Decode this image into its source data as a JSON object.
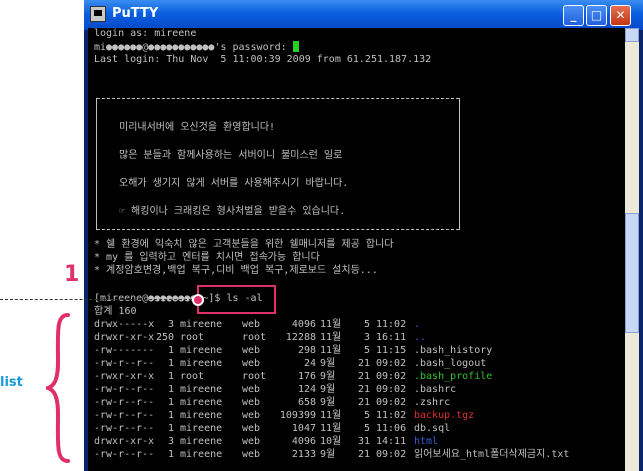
{
  "window": {
    "title": "PuTTY",
    "minimize": "_",
    "maximize": "□",
    "close": "✕"
  },
  "terminal": {
    "login_line": "login as: mireene",
    "password_line": "mi●●●●●●@●●●●●●●●●●●'s password: ",
    "last_login": "Last login: Thu Nov  5 11:00:39 2009 from 61.251.187.132",
    "banner": [
      "미리내서버에 오신것을 환영합니다!",
      "많은 분들과 함께사용하는 서버이니 불미스런 일로",
      "오해가 생기지 않게 서버를 사용해주시기 바랍니다.",
      "☞ 해킹이나 크래킹은 형사처벌을 받을수 있습니다."
    ],
    "notices": [
      "* 쉘 환경에 익숙치 않은 고객분들을 위한 쉘매니저를 제공 합니다",
      "* my 를 입력하고 엔터를 치시면 접속가능 합니다",
      "* 계정암호변경,백업 복구,디비 백업 복구,제로보드 설치등..."
    ],
    "prompt_line": "[mireene@●●●●●●●● ~]$ ls -al",
    "total_line": "합계 160",
    "rows": [
      {
        "perm": "drwx-----x",
        "links": "3",
        "owner": "mireene",
        "group": "web",
        "size": "4096",
        "mon": "11월",
        "day": "5",
        "time": "11:02",
        "name": ".",
        "color": "#3b5bd6"
      },
      {
        "perm": "drwxr-xr-x",
        "links": "250",
        "owner": "root",
        "group": "root",
        "size": "12288",
        "mon": "11월",
        "day": "3",
        "time": "16:11",
        "name": "..",
        "color": "#3b5bd6"
      },
      {
        "perm": "-rw-------",
        "links": "1",
        "owner": "mireene",
        "group": "web",
        "size": "298",
        "mon": "11월",
        "day": "5",
        "time": "11:15",
        "name": ".bash_history",
        "color": "#c0c0c0"
      },
      {
        "perm": "-rw-r--r--",
        "links": "1",
        "owner": "mireene",
        "group": "web",
        "size": "24",
        "mon": "9월",
        "day": "21",
        "time": "09:02",
        "name": ".bash_logout",
        "color": "#c0c0c0"
      },
      {
        "perm": "-rwxr-xr-x",
        "links": "1",
        "owner": "root",
        "group": "root",
        "size": "176",
        "mon": "9월",
        "day": "21",
        "time": "09:02",
        "name": ".bash_profile",
        "color": "#2ec52e"
      },
      {
        "perm": "-rw-r--r--",
        "links": "1",
        "owner": "mireene",
        "group": "web",
        "size": "124",
        "mon": "9월",
        "day": "21",
        "time": "09:02",
        "name": ".bashrc",
        "color": "#c0c0c0"
      },
      {
        "perm": "-rw-r--r--",
        "links": "1",
        "owner": "mireene",
        "group": "web",
        "size": "658",
        "mon": "9월",
        "day": "21",
        "time": "09:02",
        "name": ".zshrc",
        "color": "#c0c0c0"
      },
      {
        "perm": "-rw-r--r--",
        "links": "1",
        "owner": "mireene",
        "group": "web",
        "size": "109399",
        "mon": "11월",
        "day": "5",
        "time": "11:02",
        "name": "backup.tgz",
        "color": "#e03030"
      },
      {
        "perm": "-rw-r--r--",
        "links": "1",
        "owner": "mireene",
        "group": "web",
        "size": "1047",
        "mon": "11월",
        "day": "5",
        "time": "11:06",
        "name": "db.sql",
        "color": "#c0c0c0"
      },
      {
        "perm": "drwxr-xr-x",
        "links": "3",
        "owner": "mireene",
        "group": "web",
        "size": "4096",
        "mon": "10월",
        "day": "31",
        "time": "14:11",
        "name": "html",
        "color": "#3b5bd6"
      },
      {
        "perm": "-rw-r--r--",
        "links": "1",
        "owner": "mireene",
        "group": "web",
        "size": "2133",
        "mon": "9월",
        "day": "21",
        "time": "09:02",
        "name": "읽어보세요_html폴더삭제금지.txt",
        "color": "#c0c0c0"
      }
    ]
  },
  "annotations": {
    "step": "1",
    "list": "list",
    "accent": "#e0306a"
  }
}
